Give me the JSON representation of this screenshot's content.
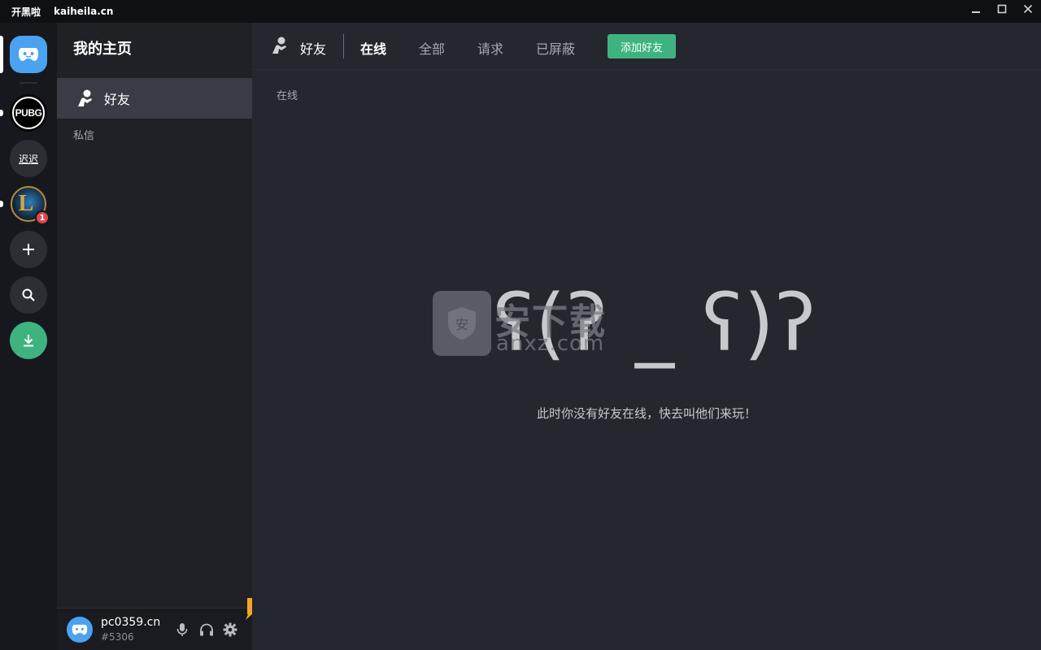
{
  "titlebar": {
    "brand": "开黑啦",
    "domain": "kaiheila.cn"
  },
  "rail": {
    "servers": [
      {
        "name": "home",
        "icon": "controller-icon"
      },
      {
        "name": "PUBG",
        "label": "PUBG"
      },
      {
        "name": "迟迟",
        "label": "迟迟"
      },
      {
        "name": "League of Legends",
        "label": "L",
        "badge": "1"
      }
    ],
    "actions": [
      "add-server-icon",
      "search-icon",
      "download-icon"
    ]
  },
  "sidebar": {
    "title": "我的主页",
    "friends_label": "好友",
    "dm_label": "私信"
  },
  "user": {
    "name": "pc0359.cn",
    "tag": "#5306"
  },
  "topbar": {
    "friends_label": "好友",
    "tabs": [
      {
        "label": "在线",
        "active": true
      },
      {
        "label": "全部",
        "active": false
      },
      {
        "label": "请求",
        "active": false
      },
      {
        "label": "已屏蔽",
        "active": false
      }
    ],
    "add_friend": "添加好友"
  },
  "main": {
    "section_label": "在线",
    "empty_face": "ʕ(ʔ _ ʕ)ʔ",
    "empty_message": "此时你没有好友在线，快去叫他们来玩！"
  },
  "watermark": {
    "line1": "安下载",
    "line2": "anxz.com"
  },
  "colors": {
    "accent_blue": "#4aa3f0",
    "accent_green": "#3fb37f",
    "badge_red": "#e0474f",
    "alert_orange": "#f5a623"
  }
}
